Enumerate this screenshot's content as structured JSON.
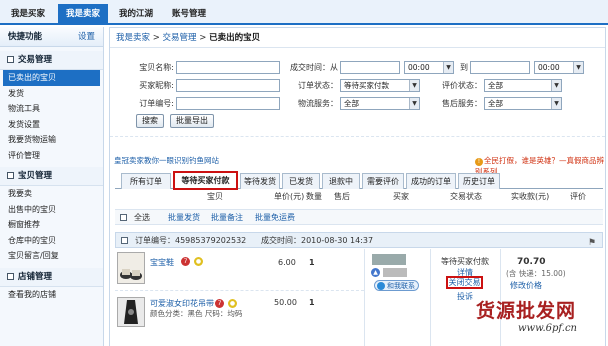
{
  "topnav": {
    "tabs": [
      {
        "label": "我是买家"
      },
      {
        "label": "我是卖家"
      },
      {
        "label": "我的江湖"
      },
      {
        "label": "账号管理"
      }
    ]
  },
  "sidebar": {
    "title": "快捷功能",
    "settings": "设置",
    "groups": [
      {
        "title": "交易管理",
        "items": [
          "已卖出的宝贝",
          "发货",
          "物流工具",
          "发货设置",
          "我要货物运输",
          "评价管理"
        ]
      },
      {
        "title": "宝贝管理",
        "items": [
          "我要卖",
          "出售中的宝贝",
          "橱窗推荐",
          "仓库中的宝贝",
          "宝贝留言/回复"
        ]
      },
      {
        "title": "店铺管理",
        "items": [
          "查看我的店铺"
        ]
      }
    ]
  },
  "breadcrumb": {
    "a": "我是卖家",
    "sep1": " > ",
    "b": "交易管理",
    "sep2": " > ",
    "c": "已卖出的宝贝"
  },
  "search": {
    "item_name": "宝贝名称:",
    "buyer_nick": "买家昵称:",
    "order_no": "订单编号:",
    "time_from": "成交时间：从",
    "hour_val": "00:00",
    "to": "到",
    "hour_val2": "00:00",
    "order_status": "订单状态：",
    "order_status_val": "等待买家付款",
    "rate_status": "评价状态：",
    "rate_status_val": "全部",
    "logistics": "物流服务：",
    "logistics_val": "全部",
    "after_sale": "售后服务：",
    "after_sale_val": "全部",
    "search_btn": "搜索",
    "export_btn": "批量导出"
  },
  "promo": {
    "left": "皇冠卖家教你一眼识别钓鱼网站",
    "right": "全民打假，谁是英雄？—真假商品辨别系列"
  },
  "order_tabs": [
    "所有订单",
    "等待买家付款",
    "等待发货",
    "已发货",
    "退款中",
    "需要评价",
    "成功的订单",
    "历史订单"
  ],
  "table_headers": [
    "宝贝",
    "单价(元)",
    "数量",
    "售后",
    "买家",
    "交易状态",
    "实收款(元)",
    "评价"
  ],
  "bulk": {
    "select_all": "全选",
    "ship": "批量发货",
    "note": "批量备注",
    "free_ship": "批量免运费"
  },
  "order": {
    "order_label": "订单编号：45985379202532",
    "time_label": "成交时间：2010-08-30 14:37",
    "items": [
      {
        "name": "宝宝鞋",
        "price": "6.00",
        "qty": "1"
      },
      {
        "name": "可爱淑女印花吊带",
        "attrs": "颜色分类：黑色   尺码：均码",
        "price": "50.00",
        "qty": "1"
      }
    ],
    "buyer_contact": "和我联系",
    "status": "等待买家付款",
    "detail": "详情",
    "close": "关闭交易",
    "complain": "投诉",
    "amount": "70.70",
    "shipping": "(含 快递：15.00)",
    "modify_price": "修改价格"
  },
  "watermark": {
    "cn": "货源批发网",
    "url": "www.6pf.cn"
  }
}
